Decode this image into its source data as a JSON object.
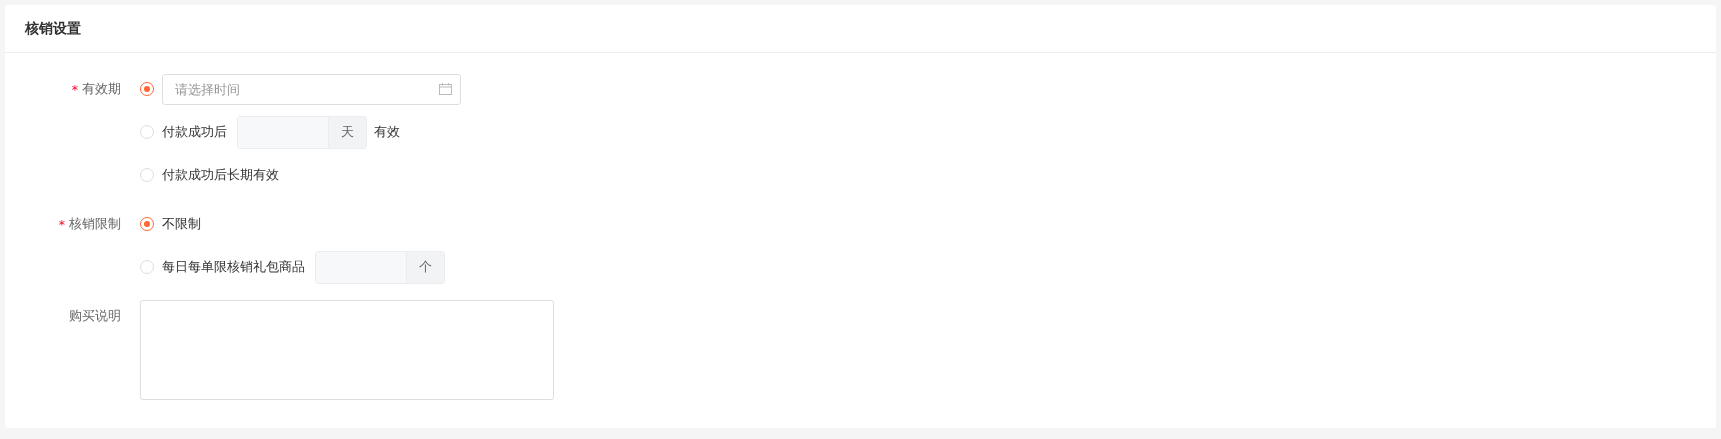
{
  "card": {
    "title": "核销设置"
  },
  "fields": [
    {
      "label": "有效期",
      "required_mark": "*",
      "kind": "radio_group",
      "options": [
        {
          "kind": "date",
          "selected": true,
          "placeholder": "请选择时间"
        },
        {
          "kind": "number",
          "selected": false,
          "label": "付款成功后",
          "unit": "天",
          "suffix": "有效",
          "disabled": true
        },
        {
          "kind": "plain",
          "selected": false,
          "label": "付款成功后长期有效"
        }
      ]
    },
    {
      "label": "核销限制",
      "required_mark": "*",
      "kind": "radio_group",
      "options": [
        {
          "kind": "plain",
          "selected": true,
          "label": "不限制"
        },
        {
          "kind": "number",
          "selected": false,
          "label": "每日每单限核销礼包商品",
          "unit": "个",
          "disabled": true
        }
      ]
    },
    {
      "label": "购买说明",
      "kind": "textarea"
    }
  ]
}
